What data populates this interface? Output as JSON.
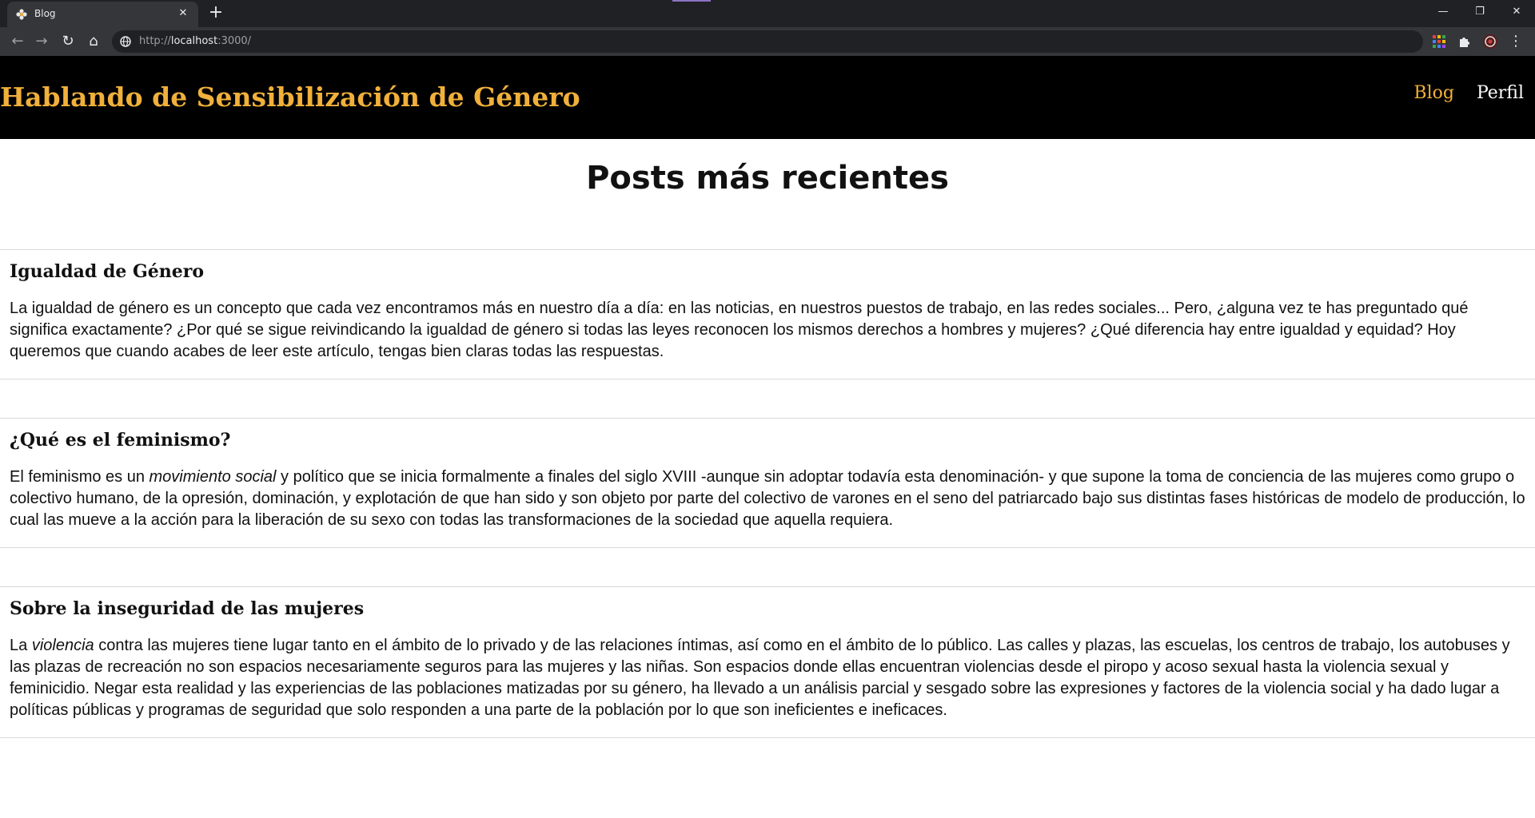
{
  "browser": {
    "tab_title": "Blog",
    "tab_close": "✕",
    "new_tab": "+",
    "url_scheme": "http://",
    "url_host": "localhost",
    "url_rest": ":3000/",
    "window_min": "—",
    "window_restore": "❐",
    "window_close": "✕",
    "nav_back": "←",
    "nav_forward": "→",
    "nav_reload": "↻",
    "nav_home": "⌂",
    "menu": "⋮"
  },
  "site": {
    "title": "Hablando de Sensibilización de Género",
    "nav": {
      "blog": "Blog",
      "perfil": "Perfil"
    },
    "accent_color": "#f0b03a"
  },
  "main": {
    "heading": "Posts más recientes"
  },
  "posts": [
    {
      "title": "Igualdad de Género",
      "body_parts": [
        "La igualdad de género es un concepto que cada vez encontramos más en nuestro día a día: en las noticias, en nuestros puestos de trabajo, en las redes sociales... Pero, ¿alguna vez te has preguntado qué significa exactamente? ¿Por qué se sigue reivindicando la igualdad de género si todas las leyes reconocen los mismos derechos a hombres y mujeres? ¿Qué diferencia hay entre igualdad y equidad? Hoy queremos que cuando acabes de leer este artículo, tengas bien claras todas las respuestas."
      ]
    },
    {
      "title": "¿Qué es el feminismo?",
      "body_parts": [
        "El feminismo es un ",
        "movimiento social",
        " y político que se inicia formalmente a finales del siglo XVIII -aunque sin adoptar todavía esta denominación- y que supone la toma de conciencia de las mujeres como grupo o colectivo humano, de la opresión, dominación, y explotación de que han sido y son objeto por parte del colectivo de varones en el seno del patriarcado bajo sus distintas fases históricas de modelo de producción, lo cual las mueve a la acción para la liberación de su sexo con todas las transformaciones de la sociedad que aquella requiera."
      ]
    },
    {
      "title": "Sobre la inseguridad de las mujeres",
      "body_parts": [
        "La ",
        "violencia",
        " contra las mujeres tiene lugar tanto en el ámbito de lo privado y de las relaciones íntimas, así como en el ámbito de lo público. Las calles y plazas, las escuelas, los centros de trabajo, los autobuses y las plazas de recreación no son espacios necesariamente seguros para las mujeres y las niñas. Son espacios donde ellas encuentran violencias desde el piropo y acoso sexual hasta la violencia sexual y feminicidio. Negar esta realidad y las experiencias de las poblaciones matizadas por su género, ha llevado a un análisis parcial y sesgado sobre las expresiones y factores de la violencia social y ha dado lugar a políticas públicas y programas de seguridad que solo responden a una parte de la población por lo que son ineficientes e ineficaces."
      ]
    }
  ]
}
